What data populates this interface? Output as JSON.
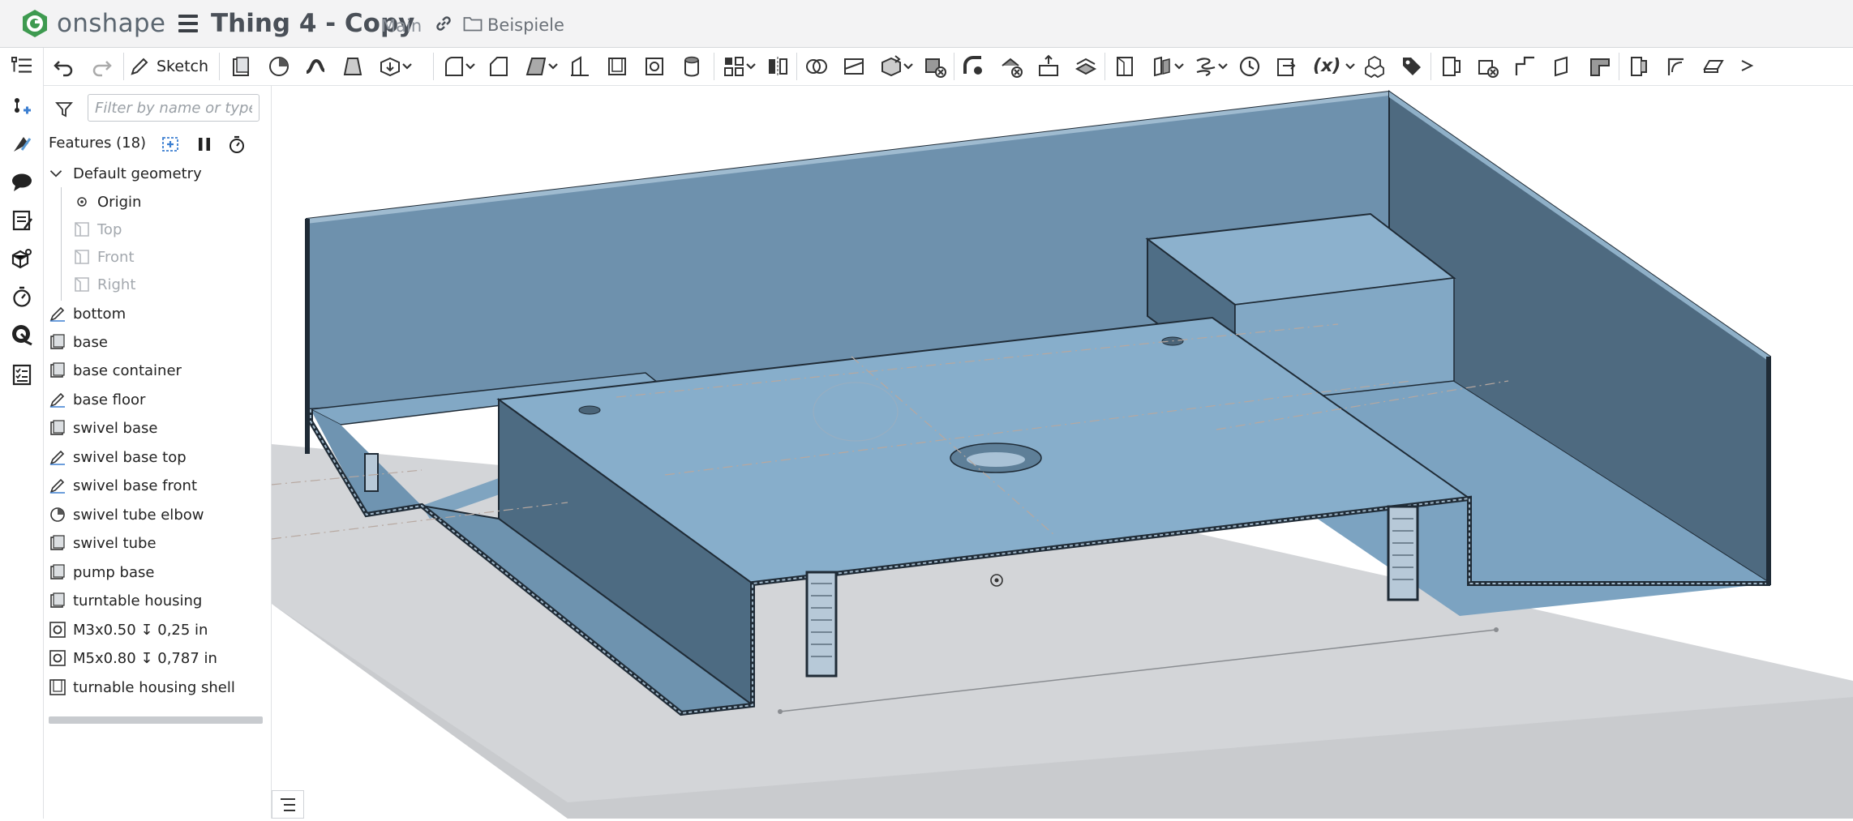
{
  "app": {
    "name": "onshape",
    "brand_color": "#3e9a50"
  },
  "document": {
    "title": "Thing 4 - Copy",
    "branch": "Main",
    "folder": "Beispiele"
  },
  "toolbar": {
    "sketch_label": "Sketch"
  },
  "feature_panel": {
    "filter_placeholder": "Filter by name or type",
    "header": "Features (18)",
    "default_geometry": {
      "label": "Default geometry",
      "items": [
        {
          "label": "Origin",
          "icon": "origin-icon",
          "disabled": false
        },
        {
          "label": "Top",
          "icon": "plane-icon",
          "disabled": true
        },
        {
          "label": "Front",
          "icon": "plane-icon",
          "disabled": true
        },
        {
          "label": "Right",
          "icon": "plane-icon",
          "disabled": true
        }
      ]
    },
    "features": [
      {
        "label": "bottom",
        "icon": "sketch-icon"
      },
      {
        "label": "base",
        "icon": "extrude-icon"
      },
      {
        "label": "base container",
        "icon": "extrude-icon"
      },
      {
        "label": "base floor",
        "icon": "sketch-icon"
      },
      {
        "label": "swivel base",
        "icon": "extrude-icon"
      },
      {
        "label": "swivel base top",
        "icon": "sketch-icon"
      },
      {
        "label": "swivel base front",
        "icon": "sketch-icon"
      },
      {
        "label": "swivel tube elbow",
        "icon": "revolve-icon"
      },
      {
        "label": "swivel tube",
        "icon": "extrude-icon"
      },
      {
        "label": "pump base",
        "icon": "extrude-icon"
      },
      {
        "label": "turntable housing",
        "icon": "extrude-icon"
      },
      {
        "label": "M3x0.50 ↧ 0,25 in",
        "icon": "hole-icon"
      },
      {
        "label": "M5x0.80 ↧ 0,787 in",
        "icon": "hole-icon"
      },
      {
        "label": "turnable housing shell",
        "icon": "shell-icon"
      }
    ]
  },
  "colors": {
    "part_face": "#7fa8c6",
    "part_dark": "#4f6d83",
    "ground": "#d2d4d7"
  }
}
